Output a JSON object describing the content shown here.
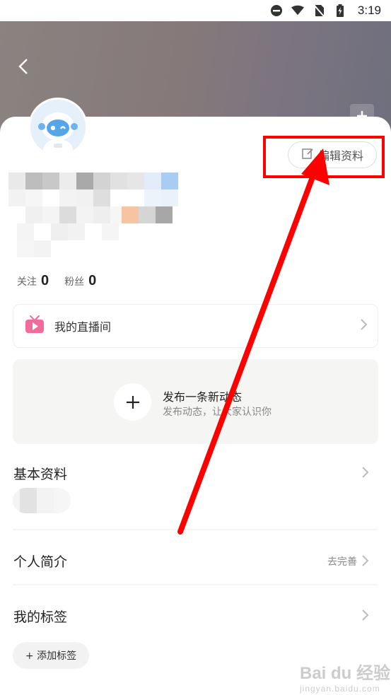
{
  "status_bar": {
    "time": "3:19",
    "icons": [
      "dnd-icon",
      "wifi-icon",
      "no-sim-icon",
      "battery-charging-icon"
    ]
  },
  "header": {
    "back_icon": "chevron-left-icon",
    "add_cover_icon": "plus-icon"
  },
  "profile": {
    "edit_label": "编辑资料",
    "edit_icon": "edit-icon"
  },
  "stats": {
    "following_label": "关注",
    "following_count": "0",
    "fans_label": "粉丝",
    "fans_count": "0"
  },
  "live_room": {
    "label": "我的直播间",
    "icon": "tv-play-icon"
  },
  "post": {
    "title": "发布一条新动态",
    "subtitle": "发布动态，让大家认识你"
  },
  "sections": {
    "basic_info": "基本资料",
    "intro": "个人简介",
    "intro_action": "去完善",
    "tags": "我的标签",
    "add_tag": "+ 添加标签"
  },
  "watermark": {
    "main": "Bai du 经验",
    "sub": "jingyan.baidu.com"
  },
  "colors": {
    "annotation": "#ff0000",
    "live_icon": "#f26b9a"
  }
}
